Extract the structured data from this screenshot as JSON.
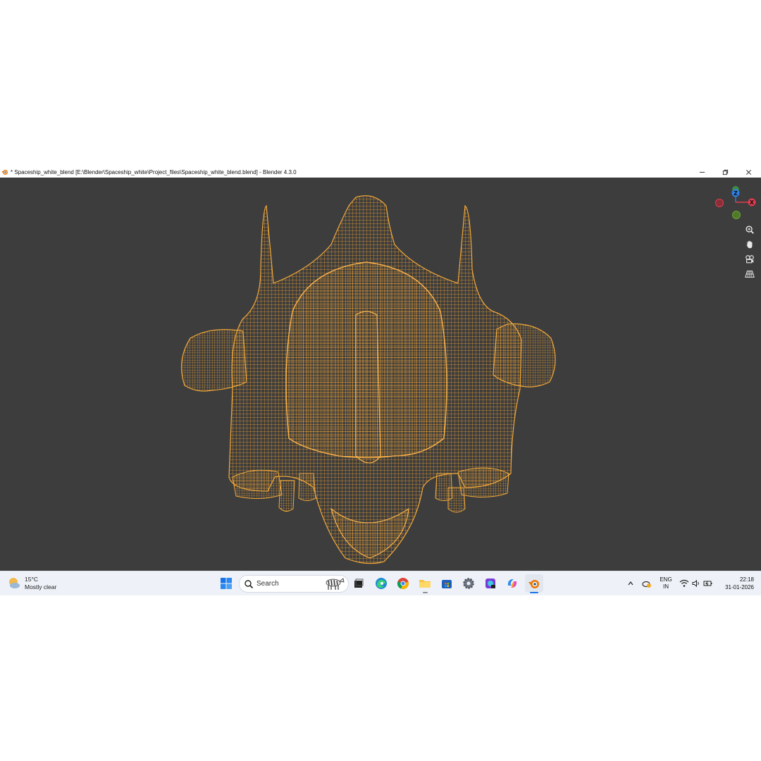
{
  "window": {
    "title": "* Spaceship_white_blend [E:\\Blender\\Spaceship_white\\Project_files\\Spaceship_white_blend.blend] - Blender 4.3.0",
    "controls": [
      "minimize-icon",
      "restore-icon",
      "close-icon"
    ]
  },
  "viewport": {
    "background": "#3d3d3d",
    "wire_color": "#f0a030",
    "gizmo": {
      "z_label": "Z",
      "x_label": "X",
      "z_color": "#2e7fe8",
      "x_color": "#e23b4f",
      "y_color": "#6ea034"
    },
    "nav_icons": [
      "zoom-icon",
      "pan-hand-icon",
      "camera-view-icon",
      "perspective-grid-icon"
    ]
  },
  "taskbar": {
    "weather": {
      "temperature": "15°C",
      "condition": "Mostly clear"
    },
    "search_placeholder": "Search",
    "apps": [
      "windows-start-icon",
      "task-view-icon",
      "edge-icon",
      "chrome-icon",
      "file-explorer-icon",
      "store-icon",
      "settings-icon",
      "app-icon",
      "copilot-icon",
      "blender-icon"
    ],
    "tray": {
      "language_line1": "ENG",
      "language_line2": "IN",
      "time": "22:18",
      "date": "31-01-2026"
    }
  }
}
